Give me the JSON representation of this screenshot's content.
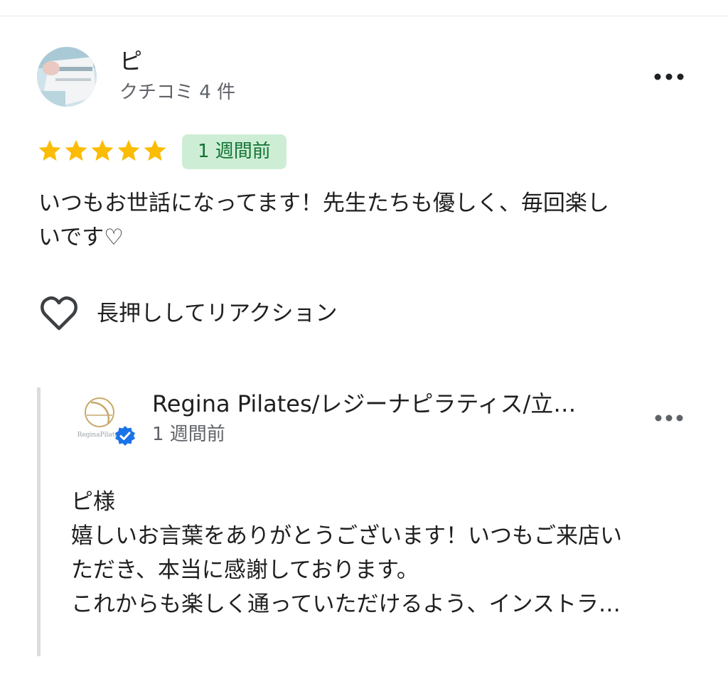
{
  "reviewer": {
    "name": "ピ",
    "review_count": "クチコミ 4 件"
  },
  "review": {
    "rating": 5,
    "max_rating": 5,
    "date": "1 週間前",
    "text": "いつもお世話になってます！先生たちも優しく、毎回楽し\nいです♡"
  },
  "reaction": {
    "label": "長押ししてリアクション",
    "icon": "heart-outline-icon"
  },
  "owner_reply": {
    "name": "Regina Pilates/レジーナピラティス/立…",
    "logo_text": "ReginaPilates",
    "date": "1 週間前",
    "text": "ピ様\n嬉しいお言葉をありがとうございます！いつもご来店い\nただき、本当に感謝しております。\nこれからも楽しく通っていただけるよう、インストラ…"
  },
  "colors": {
    "star": "#fbbc04",
    "badge_bg": "#cdeed5",
    "badge_text": "#137333",
    "verified": "#1a73e8",
    "secondary_text": "#5f6368"
  }
}
